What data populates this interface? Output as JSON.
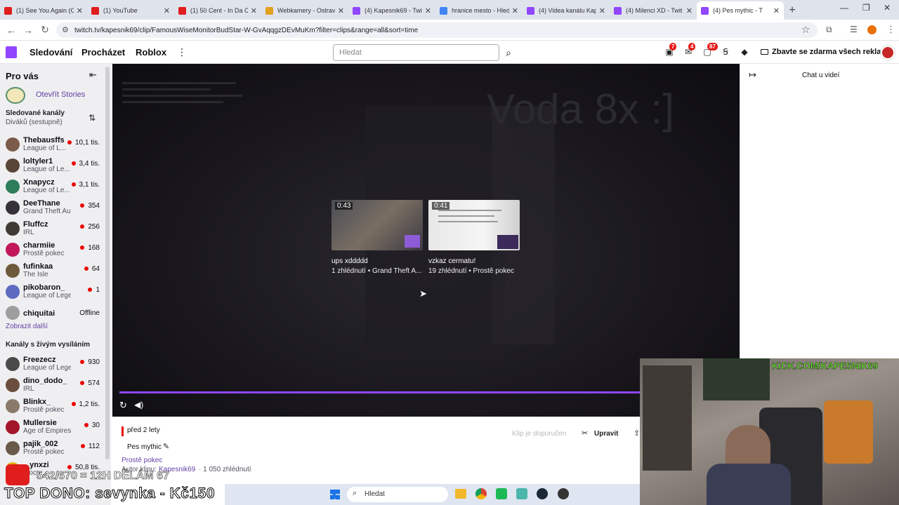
{
  "browser": {
    "tabs": [
      {
        "title": "(1) See You Again (Cl",
        "color": "#e01e1e"
      },
      {
        "title": "(1) YouTube",
        "color": "#e01e1e"
      },
      {
        "title": "(1) 50 Cent - In Da Cl",
        "color": "#e01e1e"
      },
      {
        "title": "Webkamery - Ostrav",
        "color": "#e0a020"
      },
      {
        "title": "(4) Kapesnik69 - Twit",
        "color": "#9146ff"
      },
      {
        "title": "hranice mesto - Hled",
        "color": "#4285f4"
      },
      {
        "title": "(4) Videa kanálu Kap",
        "color": "#9146ff"
      },
      {
        "title": "(4) Milenci XD - Twit",
        "color": "#9146ff"
      },
      {
        "title": "(4) Pes mythic - T",
        "color": "#9146ff"
      }
    ],
    "url": "twitch.tv/kapesnik69/clip/FamousWiseMonitorBudStar-W-GvAqqgzDEvMuKm?filter=clips&range=all&sort=time"
  },
  "topnav": {
    "links": [
      "Sledování",
      "Procházet",
      "Roblox"
    ],
    "search_placeholder": "Hledat",
    "badges": {
      "drops": "7",
      "inbox": "4",
      "notifications": "87"
    },
    "adfree": "Zbavte se zdarma všech reklam"
  },
  "sidebar": {
    "for_you": "Pro vás",
    "stories": "Otevřít Stories",
    "followed_title": "Sledované kanály",
    "followed_sort": "Diváků (sestupně)",
    "followed": [
      {
        "name": "Thebausffs",
        "game": "League of L...",
        "viewers": "10,1 tis.",
        "color": "#7b5b4a"
      },
      {
        "name": "loltyler1",
        "game": "League of Le...",
        "viewers": "3,4 tis.",
        "color": "#5a4636"
      },
      {
        "name": "Xnapycz",
        "game": "League of Le...",
        "viewers": "3,1 tis.",
        "color": "#2e7d5b"
      },
      {
        "name": "DeeThane",
        "game": "Grand Theft Au...",
        "viewers": "354",
        "color": "#35323b"
      },
      {
        "name": "Fluffcz",
        "game": "IRL",
        "viewers": "256",
        "color": "#3f3a34"
      },
      {
        "name": "charmiie",
        "game": "Prostě pokec",
        "viewers": "168",
        "color": "#c2185b"
      },
      {
        "name": "fufinkaa",
        "game": "The Isle",
        "viewers": "64",
        "color": "#6d5a3c"
      },
      {
        "name": "pikobaron_",
        "game": "League of Lege...",
        "viewers": "1",
        "color": "#5c6bc0"
      },
      {
        "name": "chiquitai",
        "game": "",
        "viewers": "Offline",
        "color": "#9e9e9e"
      }
    ],
    "show_more": "Zobrazit další",
    "live_title": "Kanály s živým vysíláním",
    "live": [
      {
        "name": "Freezecz",
        "game": "League of Lege...",
        "viewers": "930",
        "color": "#4a4a4a"
      },
      {
        "name": "dino_dodo_",
        "game": "IRL",
        "viewers": "574",
        "color": "#6b4e3d"
      },
      {
        "name": "Blinkx_",
        "game": "Prostě pokec",
        "viewers": "1,2 tis.",
        "color": "#8a7a6a"
      },
      {
        "name": "Mullersie",
        "game": "Age of Empires II",
        "viewers": "30",
        "color": "#a3162a"
      },
      {
        "name": "pajik_002",
        "game": "Prostě pokec",
        "viewers": "112",
        "color": "#6a5a4a"
      },
      {
        "name": "...ynxzi",
        "game": "...ocn...",
        "viewers": "50,8 tis.",
        "color": "#e0b000"
      }
    ]
  },
  "player": {
    "overlay_text": "Voda 8x :]",
    "chat_title": "Chat u videí",
    "clips": [
      {
        "duration": "0:43",
        "title": "ups xddddd",
        "meta": "1 zhlédnutí • Grand Theft A..."
      },
      {
        "duration": "0:41",
        "title": "vzkaz cermatu!",
        "meta": "19 zhlédnutí • Prostě pokec"
      }
    ]
  },
  "clipinfo": {
    "age": "před 2 lety",
    "recommended": "Klip je doporučen",
    "edit": "Upravit",
    "title": "Pes mythic",
    "category": "Prostě pokec",
    "author_label": "Autor klipu:",
    "author": "Kapesnik69",
    "views": "· 1 050 zhlédnutí"
  },
  "webcam": {
    "banner": "KICK.COM/KAPESNIK69"
  },
  "overlay": {
    "goal": "542/670 = 12H DĚLÁM 67",
    "top_dono": "TOP DONO: sevynka - Kč150"
  },
  "taskbar": {
    "search": "Hledat"
  }
}
